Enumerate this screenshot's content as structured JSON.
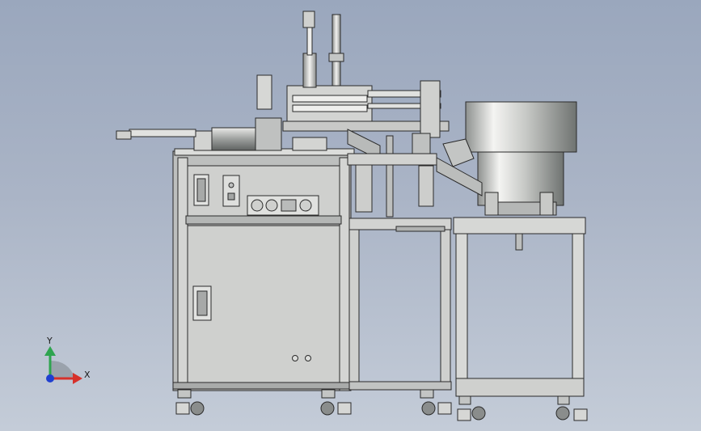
{
  "viewport": {
    "background_top": "#9aa7bd",
    "background_bottom": "#c4ccd8"
  },
  "machine": {
    "cabinet_color": "#c9cac8",
    "frame_color": "#b9bbbb",
    "steel_color": "#d8d9d6",
    "line_color": "#2a2a2a",
    "bowl_highlight": "#f4f4f2",
    "bowl_shadow": "#7d807f"
  },
  "triad": {
    "y_label": "Y",
    "x_label": "X",
    "y_color": "#2ea44f",
    "x_color": "#d6312b",
    "origin_color": "#1f3fd0"
  }
}
